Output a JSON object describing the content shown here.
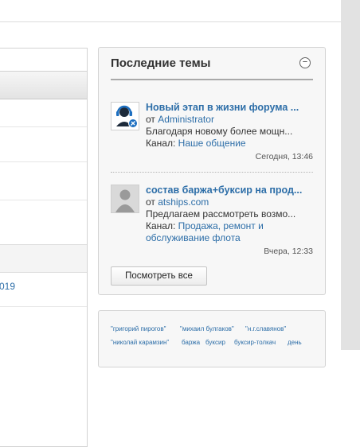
{
  "widget": {
    "title": "Последние темы",
    "collapse_glyph": "−",
    "view_all_label": "Посмотреть все",
    "topics": [
      {
        "title": "Новый этап в жизни форума ...",
        "from_prefix": "от",
        "author": "Administrator",
        "preview": "Благодаря новому более мощн...",
        "channel_prefix": "Канал:",
        "channel": "Наше общение",
        "date": "Сегодня, 13:46",
        "avatar_icon": "admin-headset-avatar-icon"
      },
      {
        "title": "состав баржа+буксир на прод...",
        "from_prefix": "от",
        "author": "atships.com",
        "preview": "Предлагаем рассмотреть возмо...",
        "channel_prefix": "Канал:",
        "channel_line1": "Продажа, ремонт и",
        "channel_line2": "обслуживание флота",
        "date": "Вчера, 12:33",
        "avatar_icon": "default-user-avatar-icon"
      }
    ]
  },
  "left_panel": {
    "link_fragment": "019"
  },
  "tags": {
    "row1": [
      "\"григорий пирогов\"",
      "\"михаил булгаков\"",
      "\"н.г.славянов\""
    ],
    "row2": [
      "\"николай карамзин\"",
      "баржа",
      "буксир",
      "буксир-толкач",
      "день"
    ]
  },
  "colors": {
    "link": "#2d6ea8",
    "panel_bg": "#f7f7f7",
    "border": "#d3d3d3"
  }
}
